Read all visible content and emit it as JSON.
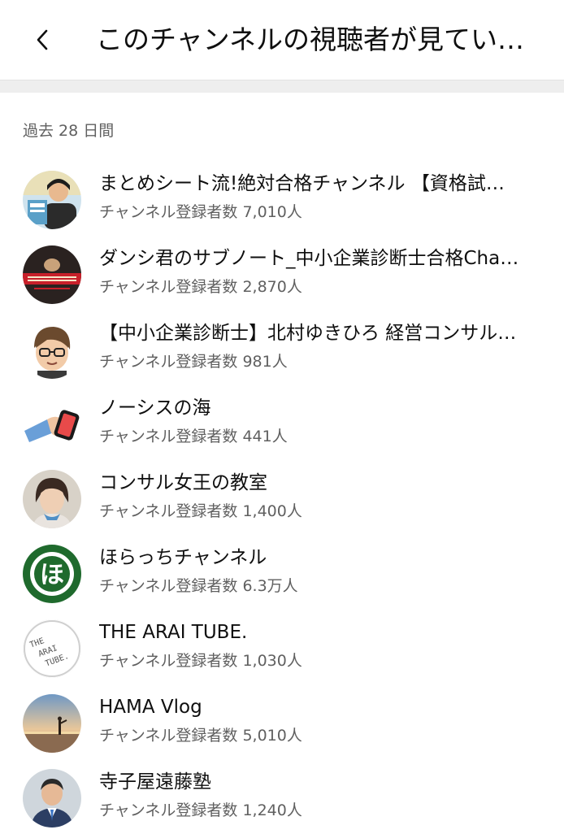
{
  "header": {
    "back_icon": "chevron-left-icon",
    "title": "このチャンネルの視聴者が見てい…"
  },
  "period_label": "過去 28 日間",
  "channels": [
    {
      "name": "まとめシート流!絶対合格チャンネル 【資格試…",
      "subscribers": "チャンネル登録者数 7,010人",
      "avatar": "person-with-book-avatar",
      "avatar_bg": "#cfe3ee"
    },
    {
      "name": "ダンシ君のサブノート_中小企業診断士合格Cha…",
      "subscribers": "チャンネル登録者数 2,870人",
      "avatar": "red-banner-avatar",
      "avatar_bg": "#2a2220"
    },
    {
      "name": "【中小企業診断士】北村ゆきひろ 経営コンサル…",
      "subscribers": "チャンネル登録者数 981人",
      "avatar": "cartoon-glasses-avatar",
      "avatar_bg": "#ffffff"
    },
    {
      "name": "ノーシスの海",
      "subscribers": "チャンネル登録者数 441人",
      "avatar": "hand-holding-phone-avatar",
      "avatar_bg": "#ffffff"
    },
    {
      "name": "コンサル女王の教室",
      "subscribers": "チャンネル登録者数 1,400人",
      "avatar": "woman-portrait-avatar",
      "avatar_bg": "#d8d2c8"
    },
    {
      "name": "ほらっちチャンネル",
      "subscribers": "チャンネル登録者数 6.3万人",
      "avatar": "ho-logo-avatar",
      "avatar_bg": "#1f6a2d"
    },
    {
      "name": "THE ARAI TUBE.",
      "subscribers": "チャンネル登録者数 1,030人",
      "avatar": "text-logo-avatar",
      "avatar_bg": "#ffffff",
      "avatar_text": [
        "THE",
        "ARAI",
        "TUBE."
      ]
    },
    {
      "name": "HAMA Vlog",
      "subscribers": "チャンネル登録者数 5,010人",
      "avatar": "sunset-beach-avatar",
      "avatar_bg": "#7fa3c8"
    },
    {
      "name": "寺子屋遠藤塾",
      "subscribers": "チャンネル登録者数 1,240人",
      "avatar": "man-in-suit-avatar",
      "avatar_bg": "#cfd6dc"
    }
  ]
}
